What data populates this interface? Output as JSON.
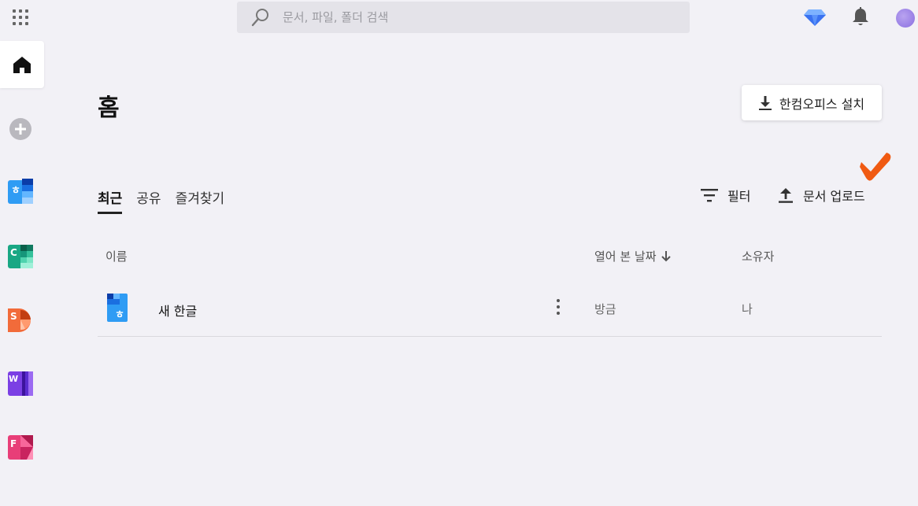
{
  "search": {
    "placeholder": "문서, 파일, 폴더 검색"
  },
  "icons": {
    "apps": "apps-grid-icon",
    "search": "search-icon",
    "premium": "diamond-icon",
    "notifications": "bell-icon",
    "home": "home-icon",
    "add": "plus-icon",
    "download": "download-icon",
    "filter": "filter-icon",
    "upload": "upload-icon",
    "sort": "arrow-down-icon",
    "more": "more-vertical-icon"
  },
  "colors": {
    "hangul": "#2f9cf4",
    "cell": "#1aa784",
    "show": "#f26b3a",
    "word": "#7b3fe4",
    "form": "#e83e78",
    "accent_check": "#f05a12"
  },
  "sidebar": {
    "apps": [
      {
        "letter": "ㅎ"
      },
      {
        "letter": "C"
      },
      {
        "letter": "S"
      },
      {
        "letter": "W"
      },
      {
        "letter": "F"
      }
    ]
  },
  "page": {
    "title": "홈"
  },
  "install_button": {
    "label": "한컴오피스 설치"
  },
  "tabs": [
    {
      "label": "최근",
      "active": true
    },
    {
      "label": "공유",
      "active": false
    },
    {
      "label": "즐겨찾기",
      "active": false
    }
  ],
  "toolbar": {
    "filter_label": "필터",
    "upload_label": "문서 업로드"
  },
  "table": {
    "headers": {
      "name": "이름",
      "date": "열어 본 날짜",
      "owner": "소유자"
    },
    "rows": [
      {
        "icon_letter": "ㅎ",
        "name": "새 한글",
        "date": "방금",
        "owner": "나"
      }
    ]
  }
}
